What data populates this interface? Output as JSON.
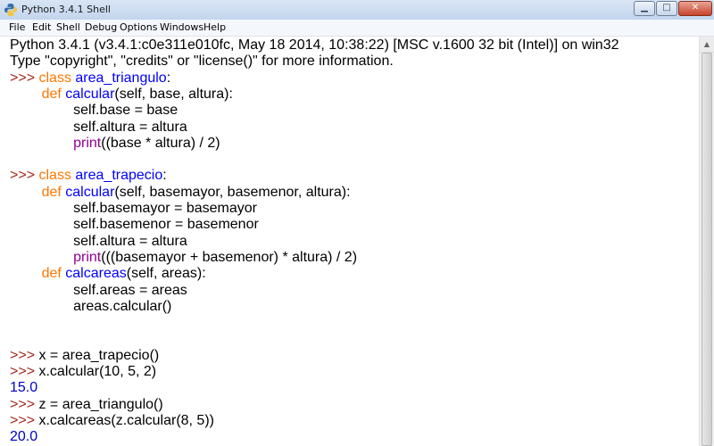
{
  "window": {
    "title": "Python 3.4.1 Shell",
    "controls": {
      "minimize": "▁",
      "maximize": "□",
      "close": "✕"
    }
  },
  "menu": [
    "File",
    "Edit",
    "Shell",
    "Debug",
    "Options",
    "Windows",
    "Help"
  ],
  "icons": {
    "app": "python-icon",
    "scroll_up": "scroll-up-arrow-icon"
  },
  "colors": {
    "prompt": "#a0281c",
    "keyword": "#ff7700",
    "definition": "#0000ff",
    "builtin": "#900090",
    "output": "#0000cc"
  },
  "shell": {
    "prompt": ">>> ",
    "lines": [
      {
        "type": "text",
        "text": "Python 3.4.1 (v3.4.1:c0e311e010fc, May 18 2014, 10:38:22) [MSC v.1600 32 bit (Intel)] on win32"
      },
      {
        "type": "text",
        "text": "Type \"copyright\", \"credits\" or \"license()\" for more information."
      },
      {
        "type": "class",
        "indent": "",
        "kw": "class",
        "name": "area_triangulo",
        "rest": ":"
      },
      {
        "type": "def",
        "indent": "        ",
        "kw": "def",
        "name": "calcular",
        "rest": "(self, base, altura):"
      },
      {
        "type": "text",
        "text": "                self.base = base"
      },
      {
        "type": "text",
        "text": "                self.altura = altura"
      },
      {
        "type": "print",
        "indent": "                ",
        "fn": "print",
        "rest": "((base * altura) / 2)"
      },
      {
        "type": "blank"
      },
      {
        "type": "class",
        "indent": "",
        "kw": "class",
        "name": "area_trapecio",
        "rest": ":"
      },
      {
        "type": "def",
        "indent": "        ",
        "kw": "def",
        "name": "calcular",
        "rest": "(self, basemayor, basemenor, altura):"
      },
      {
        "type": "text",
        "text": "                self.basemayor = basemayor"
      },
      {
        "type": "text",
        "text": "                self.basemenor = basemenor"
      },
      {
        "type": "text",
        "text": "                self.altura = altura"
      },
      {
        "type": "print",
        "indent": "                ",
        "fn": "print",
        "rest": "(((basemayor + basemenor) * altura) / 2)"
      },
      {
        "type": "def",
        "indent": "        ",
        "kw": "def",
        "name": "calcareas",
        "rest": "(self, areas):"
      },
      {
        "type": "text",
        "text": "                self.areas = areas"
      },
      {
        "type": "text",
        "text": "                areas.calcular()"
      },
      {
        "type": "blank"
      },
      {
        "type": "blank"
      },
      {
        "type": "input",
        "text": "x = area_trapecio()"
      },
      {
        "type": "input",
        "text": "x.calcular(10, 5, 2)"
      },
      {
        "type": "output",
        "text": "15.0"
      },
      {
        "type": "input",
        "text": "z = area_triangulo()"
      },
      {
        "type": "input",
        "text": "x.calcareas(z.calcular(8, 5))"
      },
      {
        "type": "output",
        "text": "20.0"
      }
    ]
  }
}
